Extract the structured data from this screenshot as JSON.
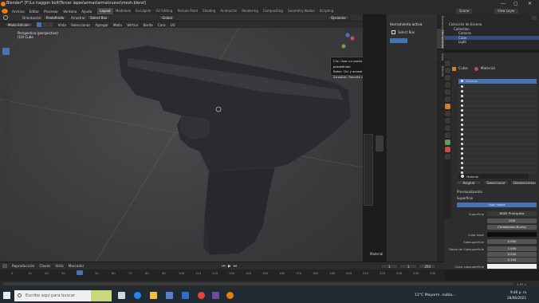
{
  "window": {
    "title": "Blender* [F:\\Lo haggon bolt\\Tercer lapse\\armas\\arma\\nuevo\\mesh.blend]",
    "minimize": "—",
    "maximize": "▢",
    "close": "✕"
  },
  "menu": {
    "items": [
      "Archivo",
      "Editar",
      "Procesar",
      "Ventana",
      "Ayuda"
    ],
    "workspaces": [
      "Layout",
      "Modelado",
      "Esculpido",
      "UV Editing",
      "Texture Paint",
      "Shading",
      "Animación",
      "Rendering",
      "Compositing",
      "Geometry Nodes",
      "Scripting"
    ],
    "active_workspace": "Layout",
    "scene_label": "Scene",
    "view_layer_label": "View Layer"
  },
  "header": {
    "orientation_label": "Orientación:",
    "orientation_value": "Predefinido",
    "drag_label": "Arrastrar:",
    "drag_value": "Select Box",
    "global_label": "Global",
    "options_label": "Opciones",
    "mode_label": "Modo Edición",
    "menus": [
      "Vista",
      "Seleccionar",
      "Agregar",
      "Malla",
      "Vértice",
      "Borde",
      "Cara",
      "UV"
    ]
  },
  "viewport": {
    "info_line1": "Perspectiva (perspective)",
    "info_line2": "(10) Cube"
  },
  "tooltip": {
    "line1": "Clic: Usar un punto de vista predefinido",
    "line2": "Rotar: Clic y arrastrar",
    "line3": "Arrastrar: Permite rotar la vista"
  },
  "npanel": {
    "title": "Herramienta activa",
    "tool": "Select Box",
    "tabs": [
      "Elemento",
      "Herramienta",
      "Vista",
      "Edición"
    ]
  },
  "strip": {
    "label": "Material"
  },
  "outliner": {
    "rows": [
      {
        "label": "Colección de Escena",
        "selected": false
      },
      {
        "label": "Collection",
        "selected": false
      },
      {
        "label": "Camera",
        "selected": false
      },
      {
        "label": "Cube",
        "selected": true
      },
      {
        "label": "Light",
        "selected": false
      }
    ]
  },
  "properties": {
    "object_name": "Cube",
    "material_tab": "Material",
    "slot_header": "Material",
    "material_name": "Material",
    "buttons": [
      "Asignar",
      "Seleccionar",
      "Deseleccionar"
    ],
    "preview_label": "Previsualización",
    "surface_label": "Superficie",
    "use_nodes": "Usar nodos",
    "surface_field_label": "Superficie",
    "surface_field_value": "BSDF Principista",
    "distribution_value": "GGX",
    "subsurface_method": "Christensen-Burley",
    "base_color_label": "Color base",
    "subsurface_label": "Subsuperficie",
    "subsurface_value": "0.000",
    "radius_label": "Radio de Subsuperficie",
    "radius_values": [
      "1.000",
      "0.200",
      "0.100"
    ],
    "subsurface_color_label": "Color subsuperficie",
    "metallic_label": "Metálico",
    "metallic_value": "0.000"
  },
  "timeline": {
    "menus": [
      "Reproducción",
      "Claves",
      "Vista",
      "Marcador"
    ],
    "frame": "1",
    "start": "1",
    "end": "250",
    "ticks": [
      "0",
      "10",
      "20",
      "30",
      "40",
      "50",
      "60",
      "70",
      "80",
      "90",
      "100",
      "110",
      "120",
      "130",
      "140",
      "150",
      "160",
      "170",
      "180",
      "190",
      "200",
      "210",
      "220",
      "230",
      "240",
      "250"
    ]
  },
  "status": {
    "version": "2.93.4"
  },
  "taskbar": {
    "search_placeholder": "Escribe aquí para buscar",
    "weather": "11°C Mayorm. nubla...",
    "time": "9:40 p. m.",
    "date": "28/06/2021"
  },
  "colors": {
    "accent": "#4772b3",
    "selected_row": "#334d80",
    "mesh": "#2c2b30"
  }
}
